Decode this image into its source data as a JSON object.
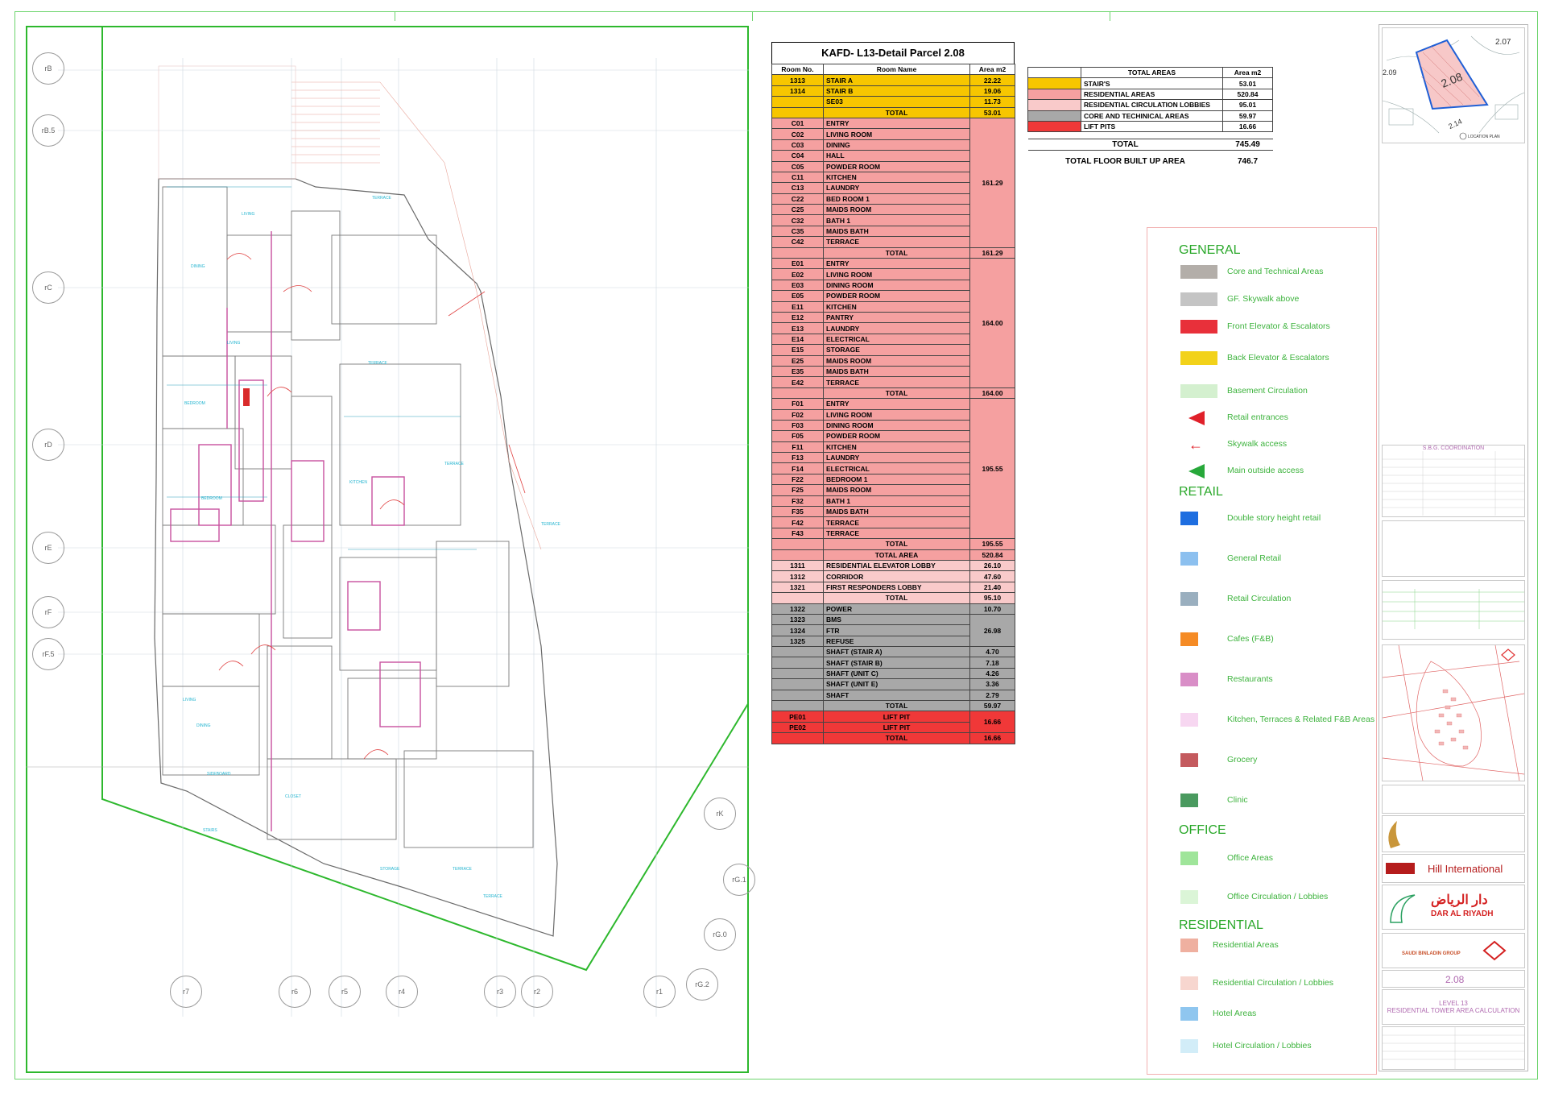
{
  "table": {
    "title": "KAFD- L13-Detail Parcel 2.08",
    "headers": [
      "Room No.",
      "Room Name",
      "Area m2"
    ],
    "rows": [
      {
        "no": "1313",
        "name": "STAIR A",
        "area": "22.22",
        "cls": "yel"
      },
      {
        "no": "1314",
        "name": "STAIR B",
        "area": "19.06",
        "cls": "yel"
      },
      {
        "no": "",
        "name": "SE03",
        "area": "11.73",
        "cls": "yel"
      },
      {
        "no": "",
        "name": "TOTAL",
        "area": "53.01",
        "cls": "yel",
        "total": true
      },
      {
        "no": "C01",
        "name": "ENTRY",
        "cls": "pnk"
      },
      {
        "no": "C02",
        "name": "LIVING ROOM",
        "cls": "pnk"
      },
      {
        "no": "C03",
        "name": "DINING",
        "cls": "pnk"
      },
      {
        "no": "C04",
        "name": "HALL",
        "cls": "pnk"
      },
      {
        "no": "C05",
        "name": "POWDER ROOM",
        "cls": "pnk"
      },
      {
        "no": "C11",
        "name": "KITCHEN",
        "cls": "pnk"
      },
      {
        "no": "C13",
        "name": "LAUNDRY",
        "cls": "pnk"
      },
      {
        "no": "C22",
        "name": "BED ROOM 1",
        "cls": "pnk"
      },
      {
        "no": "C25",
        "name": "MAIDS ROOM",
        "cls": "pnk"
      },
      {
        "no": "C32",
        "name": "BATH 1",
        "cls": "pnk"
      },
      {
        "no": "C35",
        "name": "MAIDS BATH",
        "cls": "pnk"
      },
      {
        "no": "C42",
        "name": "TERRACE",
        "cls": "pnk"
      },
      {
        "no": "",
        "name": "TOTAL",
        "area": "161.29",
        "cls": "pnk",
        "total": true
      },
      {
        "no": "E01",
        "name": "ENTRY",
        "cls": "pnk"
      },
      {
        "no": "E02",
        "name": "LIVING ROOM",
        "cls": "pnk"
      },
      {
        "no": "E03",
        "name": "DINING ROOM",
        "cls": "pnk"
      },
      {
        "no": "E05",
        "name": "POWDER ROOM",
        "cls": "pnk"
      },
      {
        "no": "E11",
        "name": "KITCHEN",
        "cls": "pnk"
      },
      {
        "no": "E12",
        "name": "PANTRY",
        "cls": "pnk"
      },
      {
        "no": "E13",
        "name": "LAUNDRY",
        "cls": "pnk"
      },
      {
        "no": "E14",
        "name": "ELECTRICAL",
        "cls": "pnk"
      },
      {
        "no": "E15",
        "name": "STORAGE",
        "cls": "pnk"
      },
      {
        "no": "E25",
        "name": "MAIDS ROOM",
        "cls": "pnk"
      },
      {
        "no": "E35",
        "name": "MAIDS BATH",
        "cls": "pnk"
      },
      {
        "no": "E42",
        "name": "TERRACE",
        "cls": "pnk"
      },
      {
        "no": "",
        "name": "TOTAL",
        "area": "164.00",
        "cls": "pnk",
        "total": true
      },
      {
        "no": "F01",
        "name": "ENTRY",
        "cls": "pnk"
      },
      {
        "no": "F02",
        "name": "LIVING ROOM",
        "cls": "pnk"
      },
      {
        "no": "F03",
        "name": "DINING ROOM",
        "cls": "pnk"
      },
      {
        "no": "F05",
        "name": "POWDER ROOM",
        "cls": "pnk"
      },
      {
        "no": "F11",
        "name": "KITCHEN",
        "cls": "pnk"
      },
      {
        "no": "F13",
        "name": "LAUNDRY",
        "cls": "pnk"
      },
      {
        "no": "F14",
        "name": "ELECTRICAL",
        "cls": "pnk"
      },
      {
        "no": "F22",
        "name": "BEDROOM 1",
        "cls": "pnk"
      },
      {
        "no": "F25",
        "name": "MAIDS ROOM",
        "cls": "pnk"
      },
      {
        "no": "F32",
        "name": "BATH 1",
        "cls": "pnk"
      },
      {
        "no": "F35",
        "name": "MAIDS BATH",
        "cls": "pnk"
      },
      {
        "no": "F42",
        "name": "TERRACE",
        "cls": "pnk"
      },
      {
        "no": "F43",
        "name": "TERRACE",
        "cls": "pnk"
      },
      {
        "no": "",
        "name": "TOTAL",
        "area": "195.55",
        "cls": "pnk",
        "total": true
      },
      {
        "no": "",
        "name": "TOTAL AREA",
        "area": "520.84",
        "cls": "pnk",
        "total": true
      },
      {
        "no": "1311",
        "name": "RESIDENTIAL ELEVATOR LOBBY",
        "area": "26.10",
        "cls": "lpk"
      },
      {
        "no": "1312",
        "name": "CORRIDOR",
        "area": "47.60",
        "cls": "lpk"
      },
      {
        "no": "1321",
        "name": "FIRST RESPONDERS LOBBY",
        "area": "21.40",
        "cls": "lpk"
      },
      {
        "no": "",
        "name": "TOTAL",
        "area": "95.10",
        "cls": "lpk",
        "total": true
      },
      {
        "no": "1322",
        "name": "POWER",
        "area": "10.70",
        "cls": "gry"
      },
      {
        "no": "1323",
        "name": "BMS",
        "cls": "gry"
      },
      {
        "no": "1324",
        "name": "FTR",
        "cls": "gry"
      },
      {
        "no": "1325",
        "name": "REFUSE",
        "cls": "gry"
      },
      {
        "no": "",
        "name": "SHAFT (STAIR A)",
        "area": "4.70",
        "cls": "gry"
      },
      {
        "no": "",
        "name": "SHAFT (STAIR B)",
        "area": "7.18",
        "cls": "gry"
      },
      {
        "no": "",
        "name": "SHAFT (UNIT C)",
        "area": "4.26",
        "cls": "gry"
      },
      {
        "no": "",
        "name": "SHAFT (UNIT E)",
        "area": "3.36",
        "cls": "gry"
      },
      {
        "no": "",
        "name": "SHAFT",
        "area": "2.79",
        "cls": "gry"
      },
      {
        "no": "",
        "name": "TOTAL",
        "area": "59.97",
        "cls": "gry",
        "total": true
      },
      {
        "no": "PE01",
        "name": "LIFT PIT",
        "cls": "red",
        "centerName": true
      },
      {
        "no": "PE02",
        "name": "LIFT PIT",
        "cls": "red",
        "centerName": true
      },
      {
        "no": "",
        "name": "TOTAL",
        "area": "16.66",
        "cls": "red",
        "total": true
      }
    ],
    "merged": {
      "c_area": "161.29",
      "e_area": "164.00",
      "f_area": "195.55",
      "bms_area": "26.98",
      "pit_area": "16.66"
    }
  },
  "totals": {
    "headers": [
      "TOTAL AREAS",
      "Area m2"
    ],
    "rows": [
      {
        "label": "STAIR'S",
        "area": "53.01",
        "color": "#f7c600"
      },
      {
        "label": "RESIDENTIAL AREAS",
        "area": "520.84",
        "color": "#f5a0a0"
      },
      {
        "label": "RESIDENTIAL CIRCULATION LOBBIES",
        "area": "95.01",
        "color": "#f9caca"
      },
      {
        "label": "CORE AND TECHINICAL AREAS",
        "area": "59.97",
        "color": "#a8a8a8"
      },
      {
        "label": "LIFT PITS",
        "area": "16.66",
        "color": "#f03838"
      }
    ],
    "total_label": "TOTAL",
    "total_value": "745.49",
    "builtup_label": "TOTAL FLOOR BUILT UP AREA",
    "builtup_value": "746.7"
  },
  "legend": {
    "general_title": "GENERAL",
    "retail_title": "RETAIL",
    "office_title": "OFFICE",
    "residential_title": "RESIDENTIAL",
    "general": [
      {
        "label": "Core and Technical Areas",
        "color": "#b3aea9",
        "shape": "box"
      },
      {
        "label": "GF. Skywalk above",
        "color": "#c4c4c4",
        "shape": "box"
      },
      {
        "label": "Front Elevator & Escalators",
        "color": "#e8303a",
        "shape": "box"
      },
      {
        "label": "Back Elevator & Escalators",
        "color": "#f2d21a",
        "shape": "box"
      },
      {
        "label": "Basement Circulation",
        "color": "#d4f0cf",
        "shape": "box"
      },
      {
        "label": "Retail entrances",
        "color": "#e0202a",
        "shape": "tri-red"
      },
      {
        "label": "Skywalk access",
        "color": "#e0202a",
        "shape": "arrow"
      },
      {
        "label": "Main outside access",
        "color": "#27a83a",
        "shape": "tri-green"
      }
    ],
    "retail": [
      {
        "label": "Double story height retail",
        "color": "#1e6ee0"
      },
      {
        "label": "General Retail",
        "color": "#8cc0ef"
      },
      {
        "label": "Retail Circulation",
        "color": "#9aafbf"
      },
      {
        "label": "Cafes (F&B)",
        "color": "#f58b25"
      },
      {
        "label": "Restaurants",
        "color": "#d98ec7"
      },
      {
        "label": "Kitchen, Terraces & Related F&B Areas",
        "color": "#f7d7f1"
      },
      {
        "label": "Grocery",
        "color": "#c45a5e"
      },
      {
        "label": "Clinic",
        "color": "#4a9a5f"
      }
    ],
    "office": [
      {
        "label": "Office Areas",
        "color": "#9fe59a"
      },
      {
        "label": "Office Circulation / Lobbies",
        "color": "#dbf5d7"
      }
    ],
    "residential": [
      {
        "label": "Residential Areas",
        "color": "#efb0a0"
      },
      {
        "label": "Residential Circulation / Lobbies",
        "color": "#f7d6cf"
      },
      {
        "label": "Hotel Areas",
        "color": "#8fc6ef"
      },
      {
        "label": "Hotel Circulation / Lobbies",
        "color": "#d2edf8"
      }
    ]
  },
  "titleblock": {
    "keyplan_label": "2.08",
    "keyplan_other": "2.07",
    "keyplan_other2": "2.14",
    "keyplan_other3": "2.09",
    "location_plan": "LOCATION PLAN",
    "coordination": "S.B.G. COORDINATION",
    "hill": "Hill International",
    "dar": "DAR AL RIYADH",
    "dar_ar": "دار الرياض",
    "sbg": "SAUDI BINLADIN GROUP",
    "building_no": "2.08",
    "drawing_title_1": "LEVEL 13",
    "drawing_title_2": "RESIDENTIAL TOWER AREA CALCULATION"
  },
  "plan": {
    "grid_left": [
      "rB",
      "rB.5",
      "rC",
      "rD",
      "rE",
      "rF",
      "rF.5"
    ],
    "grid_bottom": [
      "r7",
      "r6",
      "r5",
      "r4",
      "r3",
      "r2",
      "r1",
      "rG.2"
    ],
    "grid_right": [
      "rK",
      "rG.1",
      "rG.0"
    ]
  }
}
